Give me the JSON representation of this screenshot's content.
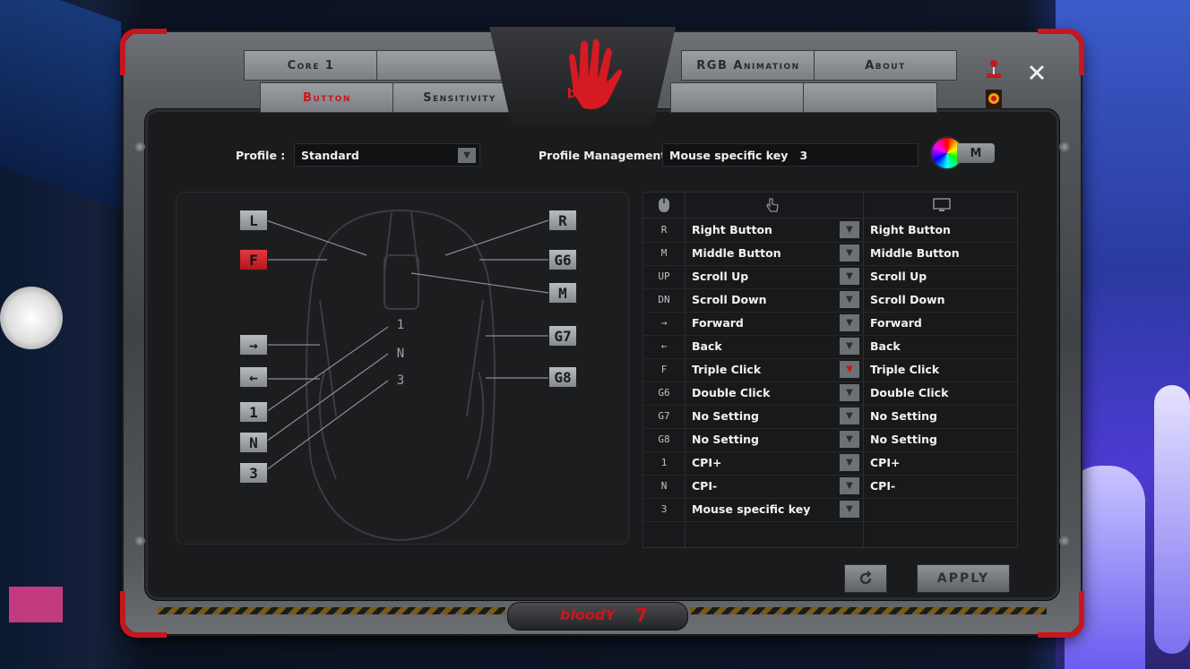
{
  "window": {
    "tabs_left": [
      {
        "label": "Core 1",
        "active": false
      },
      {
        "label": "Button",
        "active": true
      },
      {
        "label": "Sensitivity",
        "active": false
      }
    ],
    "tabs_right": [
      {
        "label": "RGB Animation"
      },
      {
        "label": "About"
      }
    ],
    "logo_text": "bloodY",
    "footer_text": "bloodY",
    "footer_version": "7"
  },
  "profile": {
    "label": "Profile :",
    "value": "Standard",
    "management_label": "Profile Management :",
    "management_value": "Mouse specific key   3",
    "m_button": "M"
  },
  "mouse_keys": {
    "left": [
      "L",
      "F",
      "→",
      "←",
      "1",
      "N",
      "3"
    ],
    "right": [
      "R",
      "G6",
      "M",
      "G7",
      "G8"
    ],
    "highlighted": "F"
  },
  "table": {
    "rows": [
      {
        "key": "R",
        "action": "Right Button",
        "assigned": "Right Button"
      },
      {
        "key": "M",
        "action": "Middle Button",
        "assigned": "Middle Button"
      },
      {
        "key": "UP",
        "action": "Scroll Up",
        "assigned": "Scroll Up"
      },
      {
        "key": "DN",
        "action": "Scroll Down",
        "assigned": "Scroll Down"
      },
      {
        "key": "→",
        "action": "Forward",
        "assigned": "Forward"
      },
      {
        "key": "←",
        "action": "Back",
        "assigned": "Back"
      },
      {
        "key": "F",
        "action": "Triple Click",
        "assigned": "Triple Click"
      },
      {
        "key": "G6",
        "action": "Double Click",
        "assigned": "Double Click"
      },
      {
        "key": "G7",
        "action": "No Setting",
        "assigned": "No Setting"
      },
      {
        "key": "G8",
        "action": "No Setting",
        "assigned": "No Setting"
      },
      {
        "key": "1",
        "action": "CPI+",
        "assigned": "CPI+"
      },
      {
        "key": "N",
        "action": "CPI-",
        "assigned": "CPI-"
      },
      {
        "key": "3",
        "action": "Mouse specific key",
        "assigned": ""
      }
    ],
    "active_row_key": "F"
  },
  "buttons": {
    "reset_icon": "refresh-icon",
    "apply": "APPLY"
  },
  "colors": {
    "accent_red": "#c8161e",
    "panel_dark": "#1a1b1d",
    "metal": "#7c7f84"
  }
}
